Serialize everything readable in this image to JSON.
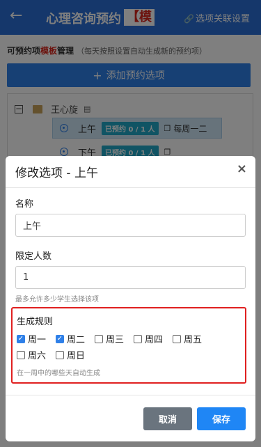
{
  "header": {
    "back_icon": "arrow-left-icon",
    "title": "心理咨询预约",
    "title_badge": "【模",
    "link_icon": "link-icon",
    "link_label": "选项关联设置"
  },
  "page": {
    "heading_part1": "可预约项",
    "heading_part2": "模板",
    "heading_part3": "管理",
    "heading_note": "（每天按照设置自动生成新的预约项）",
    "add_button": "添加预约选项",
    "tree": {
      "root_name": "王心旋",
      "items": [
        {
          "name": "上午",
          "status": "已预约 0 / 1 人",
          "schedule": "每周一二"
        },
        {
          "name": "下午",
          "status": "已预约 0 / 1 人",
          "schedule": ""
        }
      ]
    }
  },
  "modal": {
    "title": "修改选项 - 上午",
    "close_icon": "×",
    "name_label": "名称",
    "name_value": "上午",
    "limit_label": "限定人数",
    "limit_value": "1",
    "limit_hint": "最多允许多少学生选择该项",
    "rule_label": "生成规则",
    "days": [
      {
        "label": "周一",
        "checked": true
      },
      {
        "label": "周二",
        "checked": true
      },
      {
        "label": "周三",
        "checked": false
      },
      {
        "label": "周四",
        "checked": false
      },
      {
        "label": "周五",
        "checked": false
      },
      {
        "label": "周六",
        "checked": false
      },
      {
        "label": "周日",
        "checked": false
      }
    ],
    "rule_hint": "在一周中的哪些天自动生成",
    "cancel_label": "取消",
    "save_label": "保存"
  },
  "colors": {
    "header_bg": "#2a6fd6",
    "primary": "#1f86f5",
    "highlight_border": "#e02020"
  }
}
